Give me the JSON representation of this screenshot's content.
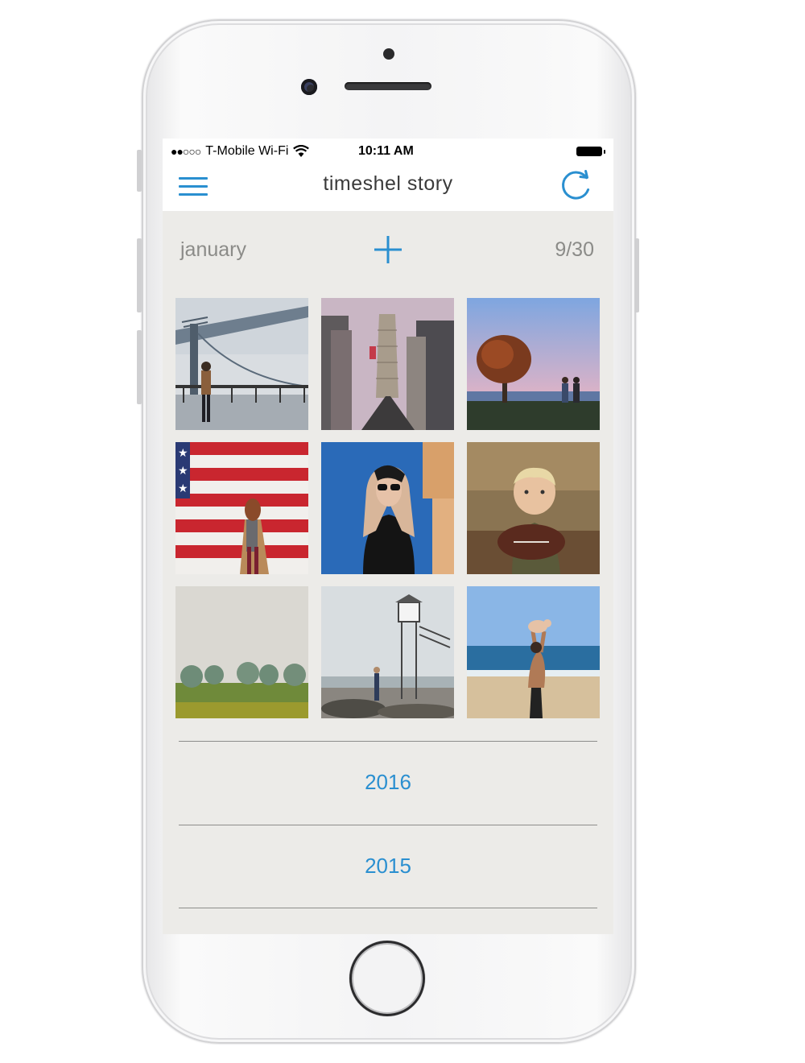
{
  "status_bar": {
    "carrier": "T-Mobile Wi-Fi",
    "signal_dots": "●●○○○",
    "time": "10:11 AM"
  },
  "navbar": {
    "title": "timeshel story",
    "menu_icon": "hamburger-menu-icon",
    "refresh_icon": "refresh-icon"
  },
  "month_header": {
    "month": "january",
    "add_icon": "plus-icon",
    "count": "9/30"
  },
  "photos": [
    {
      "subject": "bridge-with-person"
    },
    {
      "subject": "city-flatiron-building"
    },
    {
      "subject": "couple-by-tree-at-sunset"
    },
    {
      "subject": "woman-by-flag-mural"
    },
    {
      "subject": "woman-with-sunglasses-blue-wall"
    },
    {
      "subject": "toddler-with-football"
    },
    {
      "subject": "foggy-field-trees"
    },
    {
      "subject": "lifeguard-tower-on-rocks"
    },
    {
      "subject": "father-lifting-child-at-beach"
    }
  ],
  "years": [
    "2016",
    "2015"
  ],
  "colors": {
    "accent": "#2a8fd0",
    "screen_background": "#ecebe8",
    "muted_text": "#8b8b88"
  }
}
